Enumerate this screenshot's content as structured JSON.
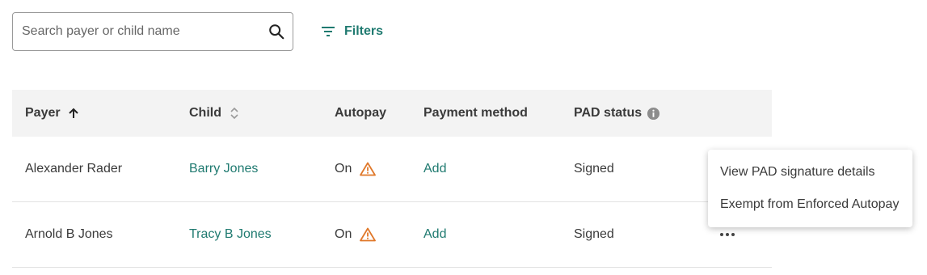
{
  "search": {
    "placeholder": "Search payer or child name",
    "value": ""
  },
  "filters": {
    "label": "Filters"
  },
  "table": {
    "columns": [
      {
        "label": "Payer",
        "sort": "ascending"
      },
      {
        "label": "Child",
        "sort": "sortable"
      },
      {
        "label": "Autopay"
      },
      {
        "label": "Payment method"
      },
      {
        "label": "PAD status",
        "icon": "info-icon"
      }
    ],
    "rows": [
      {
        "payer": "Alexander Rader",
        "child": "Barry Jones",
        "autopay": "On",
        "payment_method": "Add",
        "pad_status": "Signed"
      },
      {
        "payer": "Arnold B Jones",
        "child": "Tracy B Jones",
        "autopay": "On",
        "payment_method": "Add",
        "pad_status": "Signed"
      }
    ]
  },
  "menu": {
    "items": [
      {
        "label": "View PAD signature details"
      },
      {
        "label": "Exempt from Enforced Autopay"
      }
    ]
  },
  "colors": {
    "accent": "#1f7a70",
    "warning": "#e0782a",
    "header_bg": "#f3f3f3"
  }
}
